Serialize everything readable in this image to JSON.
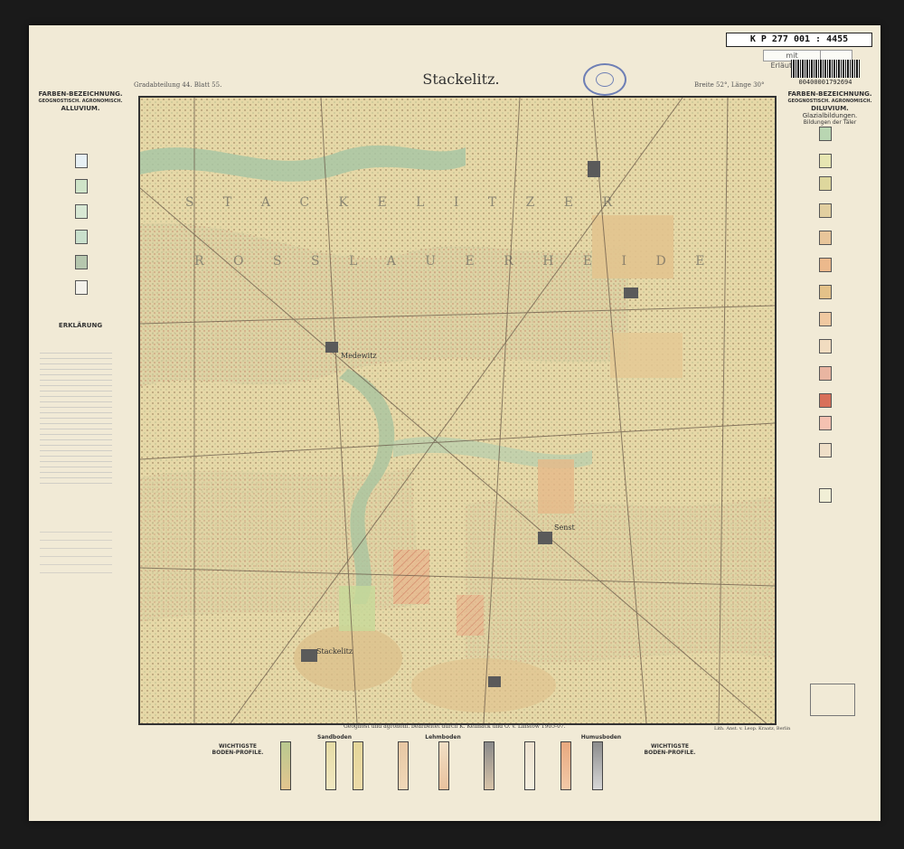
{
  "catalog": {
    "number": "K P 277 001 : 4455",
    "sticker": "mit Erläuterung",
    "barcode": "00400001792694"
  },
  "header": {
    "title": "Stackelitz.",
    "gradabteilung": "Gradabteilung 44. Blatt 55.",
    "breite": "Breite 52°, Länge 30°"
  },
  "legend_left": {
    "heading": "FARBEN-BEZEICHNUNG.",
    "sub": "GEOGNOSTISCH. AGRONOMISCH.",
    "section": "ALLUVIUM.",
    "erklaerung": "ERKLÄRUNG"
  },
  "legend_right": {
    "heading": "FARBEN-BEZEICHNUNG.",
    "sub": "GEOGNOSTISCH. AGRONOMISCH.",
    "section": "DILUVIUM.",
    "section2": "Glazialbildungen.",
    "section3": "Bildungen der Täler"
  },
  "places": [
    "Stackelitz",
    "Medewitz",
    "Senst"
  ],
  "bottom": {
    "left_title": "WICHTIGSTE BODEN-PROFILE.",
    "right_title": "WICHTIGSTE BODEN-PROFILE.",
    "sand": "Sandboden",
    "lehm": "Lehmboden",
    "humus": "Humusboden"
  },
  "credit": "Geognost und agronom. bearbeitet durch K. Keilhack und O. v. Linstow 1905-07.",
  "lith": "Lith. Anst. v. Leop. Kraatz, Berlin"
}
